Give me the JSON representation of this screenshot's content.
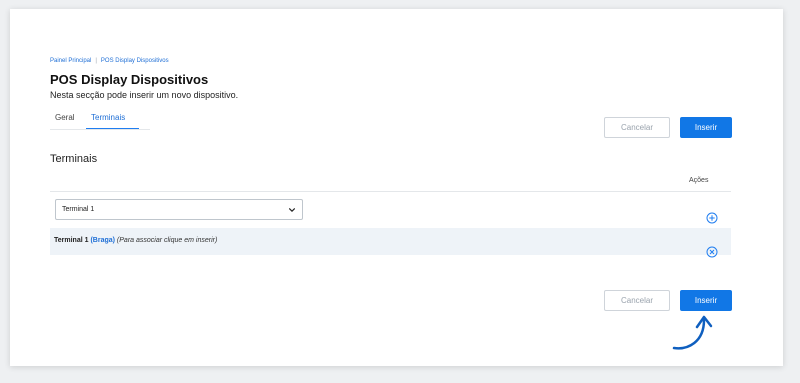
{
  "breadcrumb": {
    "items": [
      "Painel Principal",
      "POS Display Dispositivos"
    ]
  },
  "page": {
    "title": "POS Display Dispositivos",
    "subtitle": "Nesta secção pode inserir um novo dispositivo."
  },
  "tabs": [
    {
      "label": "Geral",
      "active": false
    },
    {
      "label": "Terminais",
      "active": true
    }
  ],
  "buttons": {
    "cancel_label": "Cancelar",
    "insert_label": "Inserir"
  },
  "section": {
    "title": "Terminais",
    "actions_header": "Ações"
  },
  "terminal_select": {
    "selected": "Terminal 1"
  },
  "terminal_row": {
    "name": "Terminal 1",
    "location": "(Braga)",
    "hint": "(Para associar clique em inserir)"
  },
  "colors": {
    "accent": "#1177e6",
    "row_bg": "#eef3f8",
    "link": "#1f6fd6"
  },
  "icons": {
    "add": "plus-circle-icon",
    "remove": "x-circle-icon",
    "dropdown": "chevron-down-icon",
    "annotation": "curved-arrow-icon"
  }
}
